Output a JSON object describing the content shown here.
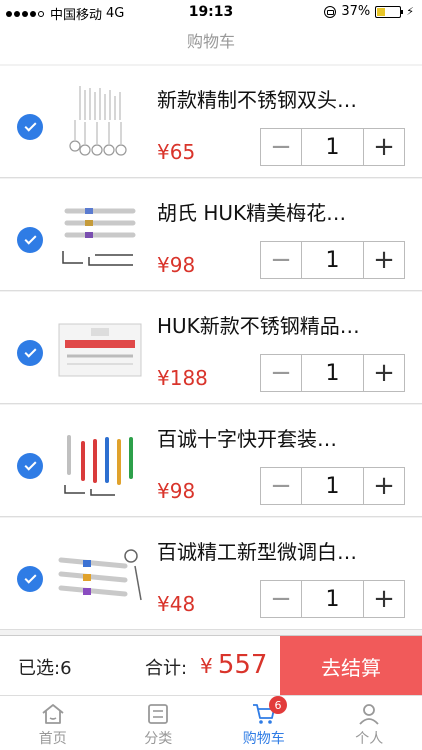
{
  "status_bar": {
    "carrier": "中国移动",
    "network": "4G",
    "time": "19:13",
    "battery": "37%"
  },
  "nav": {
    "title": "购物车"
  },
  "items": [
    {
      "title": "新款精制不锈钢双头…",
      "price": "¥65",
      "qty": "1"
    },
    {
      "title": "胡氏 HUK精美梅花…",
      "price": "¥98",
      "qty": "1"
    },
    {
      "title": "HUK新款不锈钢精品…",
      "price": "¥188",
      "qty": "1"
    },
    {
      "title": "百诚十字快开套装…",
      "price": "¥98",
      "qty": "1"
    },
    {
      "title": "百诚精工新型微调白…",
      "price": "¥48",
      "qty": "1"
    }
  ],
  "stepper": {
    "minus": "−",
    "plus": "+"
  },
  "settle": {
    "selected": "已选:6",
    "total_label": "合计:",
    "currency": "¥",
    "total": "557",
    "checkout": "去结算"
  },
  "tabs": [
    {
      "label": "首页",
      "icon": "home-icon"
    },
    {
      "label": "分类",
      "icon": "category-icon"
    },
    {
      "label": "购物车",
      "icon": "cart-icon",
      "badge": "6",
      "active": true
    },
    {
      "label": "个人",
      "icon": "user-icon"
    }
  ],
  "colors": {
    "accent": "#2f7ce5",
    "price": "#d9342b",
    "checkout": "#f15a5a"
  }
}
